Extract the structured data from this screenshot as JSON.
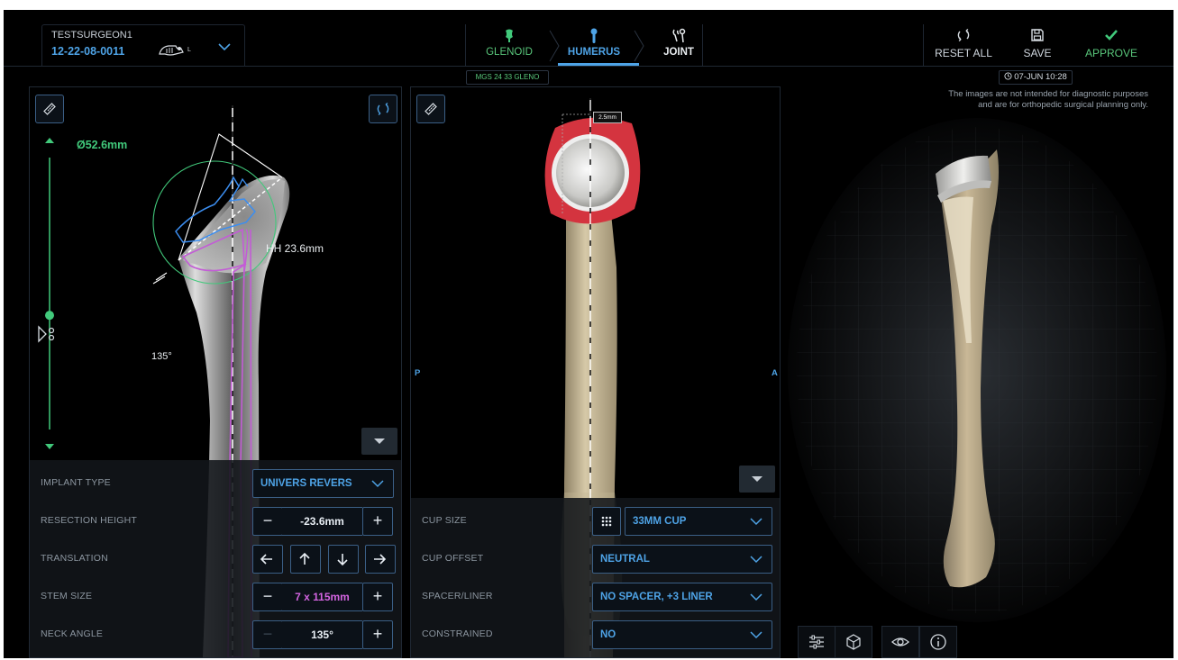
{
  "header": {
    "surgeon": "TESTSURGEON1",
    "patient_id": "12-22-08-0011",
    "side_indicator": "L",
    "patient_dropdown_icon": "chevron-down-icon",
    "workflow": [
      {
        "label": "GLENOID",
        "icon": "glenoid-icon",
        "state": "done"
      },
      {
        "label": "HUMERUS",
        "icon": "humerus-icon",
        "state": "active"
      },
      {
        "label": "JOINT",
        "icon": "joint-icon",
        "state": "pending"
      }
    ],
    "glenoid_summary": "MGS 24 33 GLENO",
    "actions": {
      "reset": "RESET ALL",
      "save": "SAVE",
      "approve": "APPROVE"
    },
    "save_timestamp": "07-JUN 10:28",
    "disclaimer_line1": "The images are not intended for diagnostic purposes",
    "disclaimer_line2": "and are for orthopedic surgical planning only."
  },
  "left_view": {
    "diameter": "Ø52.6mm",
    "head_height": "HH 23.6mm",
    "neck_angle_marker": "135°",
    "resection_slider_fraction": 0.58
  },
  "middle_view": {
    "posterior": "P",
    "anterior": "A",
    "measurement": "2.5mm"
  },
  "left_controls": [
    {
      "id": "implant_type",
      "label": "IMPLANT TYPE",
      "value": "UNIVERS REVERS"
    },
    {
      "id": "resection_height",
      "label": "RESECTION HEIGHT",
      "value": "-23.6mm"
    },
    {
      "id": "translation",
      "label": "TRANSLATION"
    },
    {
      "id": "stem_size",
      "label": "STEM SIZE",
      "value": "7 x 115mm"
    },
    {
      "id": "neck_angle",
      "label": "NECK ANGLE",
      "value": "135°"
    }
  ],
  "middle_controls": [
    {
      "id": "cup_size",
      "label": "CUP SIZE",
      "value": "33MM CUP"
    },
    {
      "id": "cup_offset",
      "label": "CUP OFFSET",
      "value": "NEUTRAL"
    },
    {
      "id": "spacer_liner",
      "label": "SPACER/LINER",
      "value": "NO SPACER, +3 LINER"
    },
    {
      "id": "constrained",
      "label": "CONSTRAINED",
      "value": "NO"
    }
  ],
  "toolbar_icons": [
    "sliders-icon",
    "model-view-icon",
    "eye-icon",
    "info-icon"
  ],
  "colors": {
    "accent_blue": "#4ea3e6",
    "accent_green": "#41c97b",
    "stem_magenta": "#d264e0",
    "cup_red": "#d4343f",
    "bone": "#c9b897"
  }
}
